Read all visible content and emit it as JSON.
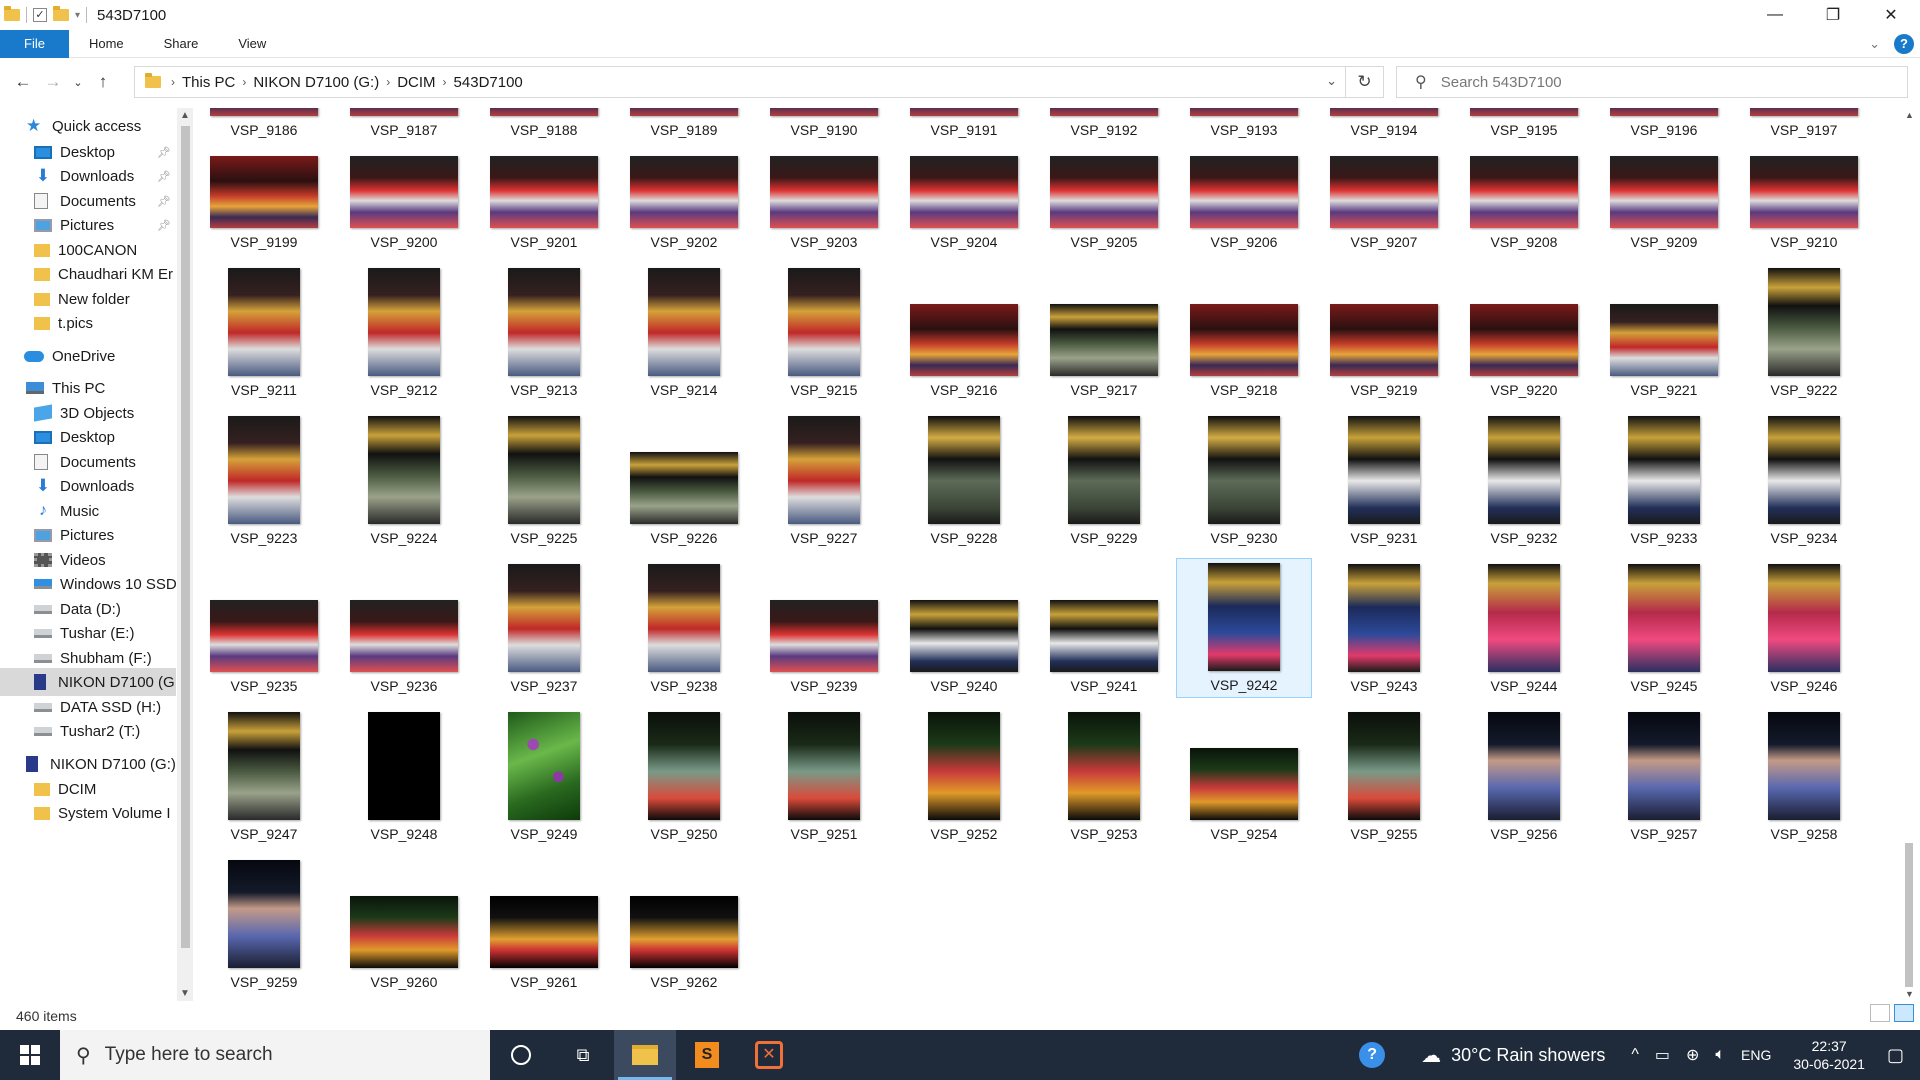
{
  "window": {
    "title": "543D7100",
    "controls": {
      "minimize": "—",
      "maximize": "❐",
      "close": "✕"
    }
  },
  "ribbon": {
    "tabs": [
      "File",
      "Home",
      "Share",
      "View"
    ]
  },
  "address": {
    "crumbs": [
      "This PC",
      "NIKON D7100 (G:)",
      "DCIM",
      "543D7100"
    ],
    "search_placeholder": "Search 543D7100"
  },
  "nav": {
    "items": [
      {
        "label": "Quick access",
        "icon": "star-icon"
      },
      {
        "label": "Desktop",
        "icon": "desktop-icon",
        "pinned": true
      },
      {
        "label": "Downloads",
        "icon": "download-icon",
        "pinned": true
      },
      {
        "label": "Documents",
        "icon": "document-icon",
        "pinned": true
      },
      {
        "label": "Pictures",
        "icon": "pictures-icon",
        "pinned": true
      },
      {
        "label": "100CANON",
        "icon": "folder-icon"
      },
      {
        "label": "Chaudhari KM Er",
        "icon": "folder-icon"
      },
      {
        "label": "New folder",
        "icon": "folder-icon"
      },
      {
        "label": "t.pics",
        "icon": "folder-icon"
      },
      {
        "label": "OneDrive",
        "icon": "cloud-icon"
      },
      {
        "label": "This PC",
        "icon": "computer-icon"
      },
      {
        "label": "3D Objects",
        "icon": "cube-icon"
      },
      {
        "label": "Desktop",
        "icon": "desktop-icon"
      },
      {
        "label": "Documents",
        "icon": "document-icon"
      },
      {
        "label": "Downloads",
        "icon": "download-icon"
      },
      {
        "label": "Music",
        "icon": "music-icon"
      },
      {
        "label": "Pictures",
        "icon": "pictures-icon"
      },
      {
        "label": "Videos",
        "icon": "video-icon"
      },
      {
        "label": "Windows 10 SSD",
        "icon": "windows-drive-icon"
      },
      {
        "label": "Data (D:)",
        "icon": "drive-icon"
      },
      {
        "label": "Tushar (E:)",
        "icon": "drive-icon"
      },
      {
        "label": "Shubham (F:)",
        "icon": "drive-icon"
      },
      {
        "label": "NIKON D7100 (G",
        "icon": "camera-drive-icon",
        "selected": true
      },
      {
        "label": "DATA SSD (H:)",
        "icon": "drive-icon"
      },
      {
        "label": "Tushar2 (T:)",
        "icon": "drive-icon"
      },
      {
        "label": "NIKON D7100 (G:)",
        "icon": "camera-drive-icon"
      },
      {
        "label": "DCIM",
        "icon": "folder-icon"
      },
      {
        "label": "System Volume I",
        "icon": "folder-icon"
      }
    ]
  },
  "files": [
    {
      "name": "VSP_9186",
      "tone": "party",
      "shape": "land"
    },
    {
      "name": "VSP_9187",
      "tone": "party",
      "shape": "land"
    },
    {
      "name": "VSP_9188",
      "tone": "party",
      "shape": "land"
    },
    {
      "name": "VSP_9189",
      "tone": "party",
      "shape": "land"
    },
    {
      "name": "VSP_9190",
      "tone": "party",
      "shape": "land"
    },
    {
      "name": "VSP_9191",
      "tone": "party",
      "shape": "land"
    },
    {
      "name": "VSP_9192",
      "tone": "party",
      "shape": "land"
    },
    {
      "name": "VSP_9193",
      "tone": "party",
      "shape": "land"
    },
    {
      "name": "VSP_9194",
      "tone": "party",
      "shape": "land"
    },
    {
      "name": "VSP_9195",
      "tone": "party",
      "shape": "land"
    },
    {
      "name": "VSP_9196",
      "tone": "party",
      "shape": "land"
    },
    {
      "name": "VSP_9197",
      "tone": "party",
      "shape": "land"
    },
    {
      "name": "VSP_9199",
      "tone": "party",
      "shape": "land"
    },
    {
      "name": "VSP_9200",
      "tone": "group",
      "shape": "land"
    },
    {
      "name": "VSP_9201",
      "tone": "group",
      "shape": "land"
    },
    {
      "name": "VSP_9202",
      "tone": "group",
      "shape": "land"
    },
    {
      "name": "VSP_9203",
      "tone": "group",
      "shape": "land"
    },
    {
      "name": "VSP_9204",
      "tone": "group",
      "shape": "land"
    },
    {
      "name": "VSP_9205",
      "tone": "group",
      "shape": "land"
    },
    {
      "name": "VSP_9206",
      "tone": "group",
      "shape": "land"
    },
    {
      "name": "VSP_9207",
      "tone": "group",
      "shape": "land"
    },
    {
      "name": "VSP_9208",
      "tone": "group",
      "shape": "land"
    },
    {
      "name": "VSP_9209",
      "tone": "group",
      "shape": "land"
    },
    {
      "name": "VSP_9210",
      "tone": "group",
      "shape": "land"
    },
    {
      "name": "VSP_9211",
      "tone": "duo",
      "shape": "port"
    },
    {
      "name": "VSP_9212",
      "tone": "duo",
      "shape": "port"
    },
    {
      "name": "VSP_9213",
      "tone": "duo",
      "shape": "port"
    },
    {
      "name": "VSP_9214",
      "tone": "duo",
      "shape": "port"
    },
    {
      "name": "VSP_9215",
      "tone": "duo",
      "shape": "port"
    },
    {
      "name": "VSP_9216",
      "tone": "party",
      "shape": "land"
    },
    {
      "name": "VSP_9217",
      "tone": "happy",
      "shape": "land"
    },
    {
      "name": "VSP_9218",
      "tone": "party",
      "shape": "land"
    },
    {
      "name": "VSP_9219",
      "tone": "party",
      "shape": "land"
    },
    {
      "name": "VSP_9220",
      "tone": "party",
      "shape": "land"
    },
    {
      "name": "VSP_9221",
      "tone": "duo",
      "shape": "land"
    },
    {
      "name": "VSP_9222",
      "tone": "happy",
      "shape": "port"
    },
    {
      "name": "VSP_9223",
      "tone": "duo",
      "shape": "port"
    },
    {
      "name": "VSP_9224",
      "tone": "happy",
      "shape": "port"
    },
    {
      "name": "VSP_9225",
      "tone": "happy",
      "shape": "port"
    },
    {
      "name": "VSP_9226",
      "tone": "happy",
      "shape": "land"
    },
    {
      "name": "VSP_9227",
      "tone": "duo",
      "shape": "port"
    },
    {
      "name": "VSP_9228",
      "tone": "green",
      "shape": "port"
    },
    {
      "name": "VSP_9229",
      "tone": "green",
      "shape": "port"
    },
    {
      "name": "VSP_9230",
      "tone": "green",
      "shape": "port"
    },
    {
      "name": "VSP_9231",
      "tone": "man",
      "shape": "port"
    },
    {
      "name": "VSP_9232",
      "tone": "man",
      "shape": "port"
    },
    {
      "name": "VSP_9233",
      "tone": "man",
      "shape": "port"
    },
    {
      "name": "VSP_9234",
      "tone": "man",
      "shape": "port"
    },
    {
      "name": "VSP_9235",
      "tone": "group",
      "shape": "land"
    },
    {
      "name": "VSP_9236",
      "tone": "group",
      "shape": "land"
    },
    {
      "name": "VSP_9237",
      "tone": "duo",
      "shape": "port"
    },
    {
      "name": "VSP_9238",
      "tone": "duo",
      "shape": "port"
    },
    {
      "name": "VSP_9239",
      "tone": "group",
      "shape": "land"
    },
    {
      "name": "VSP_9240",
      "tone": "man",
      "shape": "land"
    },
    {
      "name": "VSP_9241",
      "tone": "man",
      "shape": "land"
    },
    {
      "name": "VSP_9242",
      "tone": "lady",
      "shape": "port",
      "selected": true
    },
    {
      "name": "VSP_9243",
      "tone": "lady",
      "shape": "port"
    },
    {
      "name": "VSP_9244",
      "tone": "pink",
      "shape": "port"
    },
    {
      "name": "VSP_9245",
      "tone": "pink",
      "shape": "port"
    },
    {
      "name": "VSP_9246",
      "tone": "pink",
      "shape": "port"
    },
    {
      "name": "VSP_9247",
      "tone": "happy",
      "shape": "port"
    },
    {
      "name": "VSP_9248",
      "tone": "black",
      "shape": "port"
    },
    {
      "name": "VSP_9249",
      "tone": "leaf",
      "shape": "port"
    },
    {
      "name": "VSP_9250",
      "tone": "night",
      "shape": "port"
    },
    {
      "name": "VSP_9251",
      "tone": "night",
      "shape": "port"
    },
    {
      "name": "VSP_9252",
      "tone": "nightg",
      "shape": "port"
    },
    {
      "name": "VSP_9253",
      "tone": "nightg",
      "shape": "port"
    },
    {
      "name": "VSP_9254",
      "tone": "nightg",
      "shape": "land"
    },
    {
      "name": "VSP_9255",
      "tone": "night",
      "shape": "port"
    },
    {
      "name": "VSP_9256",
      "tone": "guy",
      "shape": "port"
    },
    {
      "name": "VSP_9257",
      "tone": "guy",
      "shape": "port"
    },
    {
      "name": "VSP_9258",
      "tone": "guy",
      "shape": "port"
    },
    {
      "name": "VSP_9259",
      "tone": "guy",
      "shape": "port"
    },
    {
      "name": "VSP_9260",
      "tone": "nightg",
      "shape": "land"
    },
    {
      "name": "VSP_9261",
      "tone": "dark",
      "shape": "land"
    },
    {
      "name": "VSP_9262",
      "tone": "dark",
      "shape": "land"
    }
  ],
  "status": {
    "items": "460 items"
  },
  "taskbar": {
    "search_placeholder": "Type here to search",
    "weather": "30°C  Rain showers",
    "lang": "ENG",
    "time": "22:37",
    "date": "30-06-2021"
  }
}
